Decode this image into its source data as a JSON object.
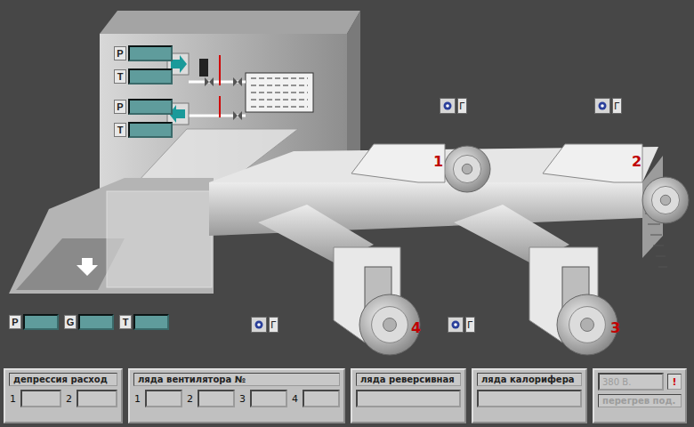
{
  "cabinet": {
    "supply": [
      {
        "label": "P"
      },
      {
        "label": "T"
      }
    ],
    "return": [
      {
        "label": "P"
      },
      {
        "label": "T"
      }
    ]
  },
  "fans": [
    {
      "number": "1"
    },
    {
      "number": "2"
    },
    {
      "number": "3"
    },
    {
      "number": "4"
    }
  ],
  "indicators": [
    {
      "symbol": "Г"
    },
    {
      "symbol": "Г"
    },
    {
      "symbol": "Г"
    },
    {
      "symbol": "Г"
    }
  ],
  "inlet": [
    {
      "label": "P"
    },
    {
      "label": "G"
    },
    {
      "label": "T"
    }
  ],
  "bottom_panel": {
    "groups": [
      {
        "title": "депрессия расход",
        "fields": [
          {
            "label": "1"
          },
          {
            "label": "2"
          }
        ]
      },
      {
        "title": "ляда вентилятора №",
        "fields": [
          {
            "label": "1"
          },
          {
            "label": "2"
          },
          {
            "label": "3"
          },
          {
            "label": "4"
          }
        ]
      },
      {
        "title": "ляда реверсивная",
        "fields": [
          {
            "label": ""
          }
        ]
      },
      {
        "title": "ляда калорифера",
        "fields": [
          {
            "label": ""
          }
        ]
      }
    ],
    "power": {
      "voltage": "380 В.",
      "alarm": "!",
      "overheat": "перегрев под.",
      "disabled": true
    }
  }
}
